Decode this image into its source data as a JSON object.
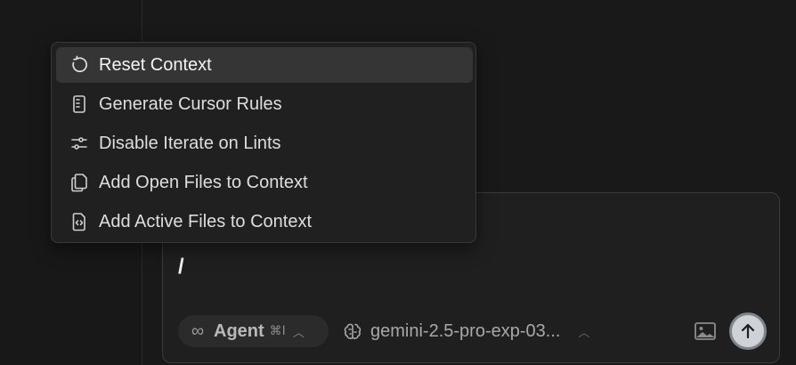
{
  "colors": {
    "background": "#191919",
    "menu_bg": "#202020",
    "menu_active": "#353535",
    "composer_bg": "#1f1f1f",
    "send_button": "#cfd3d8"
  },
  "menu": {
    "items": [
      {
        "label": "Reset Context",
        "icon": "refresh-icon",
        "active": true
      },
      {
        "label": "Generate Cursor Rules",
        "icon": "document-icon",
        "active": false
      },
      {
        "label": "Disable Iterate on Lints",
        "icon": "sliders-icon",
        "active": false
      },
      {
        "label": "Add Open Files to Context",
        "icon": "copy-files-icon",
        "active": false
      },
      {
        "label": "Add Active Files to Context",
        "icon": "code-file-icon",
        "active": false
      }
    ]
  },
  "composer": {
    "input_value": "/",
    "mode": {
      "label": "Agent",
      "shortcut": "⌘I",
      "icon": "infinity-icon"
    },
    "model": {
      "label": "gemini-2.5-pro-exp-03...",
      "icon": "brain-icon"
    },
    "image_icon": "image-icon",
    "send_icon": "arrow-up-icon"
  }
}
